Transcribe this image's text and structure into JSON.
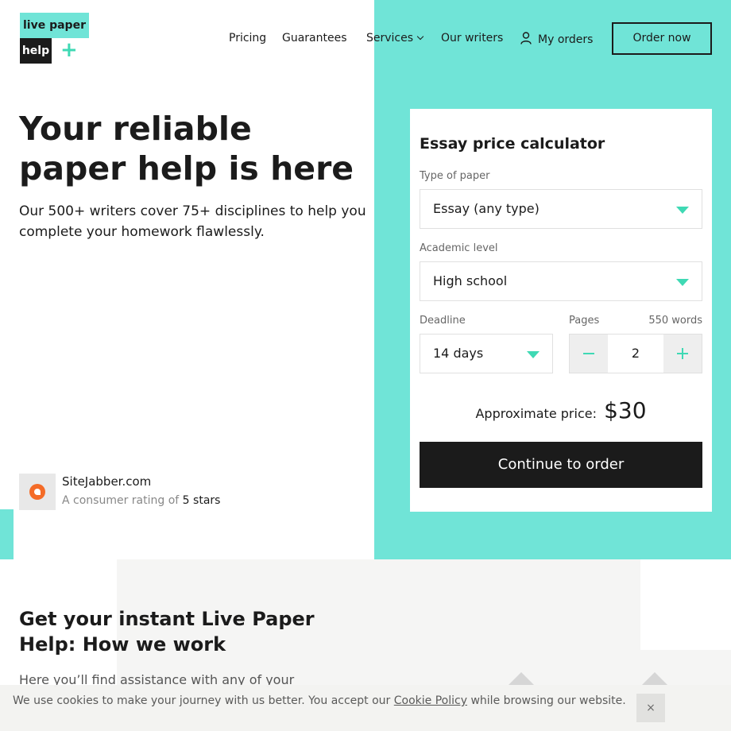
{
  "logo": {
    "top": "live paper",
    "bottom": "help",
    "plus": "+"
  },
  "nav": {
    "items": [
      "Pricing",
      "Guarantees",
      "Services",
      "Our writers",
      "My orders"
    ],
    "order_button": "Order now"
  },
  "hero": {
    "title": "Your reliable paper help is here",
    "subtitle": "Our 500+ writers cover 75+ disciplines to help you complete your homework flawlessly."
  },
  "rating": {
    "site": "SiteJabber.com",
    "text": "A consumer rating of",
    "stars": "5 stars"
  },
  "calculator": {
    "title": "Essay price calculator",
    "paper_label": "Type of paper",
    "paper_value": "Essay (any type)",
    "level_label": "Academic level",
    "level_value": "High school",
    "deadline_label": "Deadline",
    "deadline_value": "14 days",
    "pages_label": "Pages",
    "words": "550 words",
    "pages_value": "2",
    "price_label": "Approximate price:",
    "price_value": "$30",
    "continue_button": "Continue to order"
  },
  "how": {
    "title": "Get your instant Live Paper Help: How we work",
    "text": "Here you’ll find assistance with any of your"
  },
  "cookie": {
    "text_before": "We use cookies to make your journey with us better. You accept our",
    "link": "Cookie Policy",
    "text_after": "while browsing our website.",
    "close": "×"
  },
  "colors": {
    "accent": "#70e4d7",
    "icon_accent": "#3fd9b4",
    "dark": "#1b1b1b"
  }
}
